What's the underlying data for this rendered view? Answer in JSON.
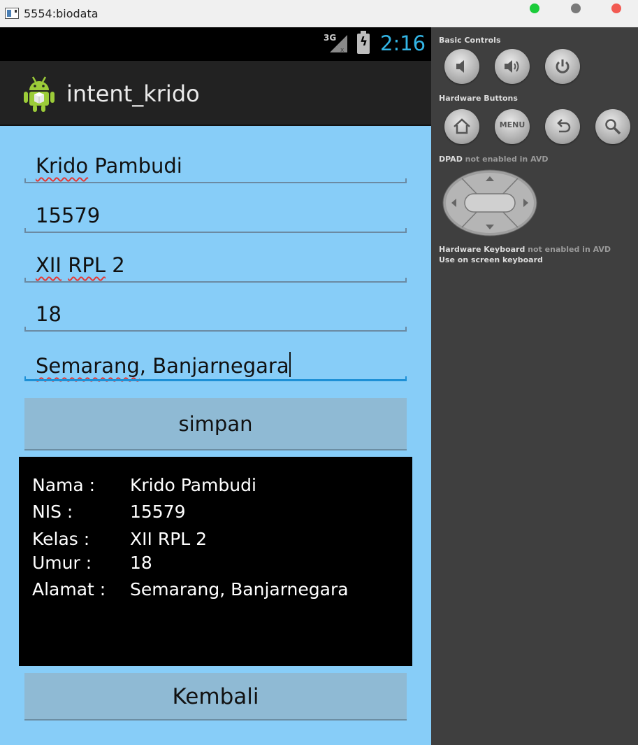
{
  "window": {
    "title": "5554:biodata"
  },
  "statusbar": {
    "network": "3G",
    "time": "2:16"
  },
  "actionbar": {
    "app_title": "intent_krido"
  },
  "form": {
    "nama": {
      "part1": "Krido",
      "part2": " Pambudi"
    },
    "nis": "15579",
    "kelas": {
      "part1": "XII",
      "part2": " ",
      "part3": "RPL",
      "part4": " 2"
    },
    "umur": "18",
    "alamat": {
      "part1": "Semarang",
      "part2": ", Banjarnegara"
    }
  },
  "buttons": {
    "simpan": "simpan",
    "kembali": "Kembali"
  },
  "output": {
    "rows": [
      {
        "label": "Nama :",
        "value": "Krido Pambudi"
      },
      {
        "label": "NIS :",
        "value": "15579"
      },
      {
        "label": "Kelas :",
        "value": "XII RPL 2"
      },
      {
        "label": "Umur :",
        "value": "18"
      },
      {
        "label": "Alamat :",
        "value": "Semarang, Banjarnegara"
      }
    ]
  },
  "panel": {
    "basic_controls": "Basic Controls",
    "hardware_buttons": "Hardware Buttons",
    "menu_label": "MENU",
    "dpad_bold": "DPAD",
    "dpad_rest": " not enabled in AVD",
    "keyboard_bold": "Hardware Keyboard",
    "keyboard_rest": " not enabled in AVD",
    "keyboard_note": "Use on screen keyboard"
  },
  "colors": {
    "background": "#87cdf8",
    "button": "#8fbad4",
    "clock": "#33b5e5",
    "focus": "#1e90d6"
  }
}
